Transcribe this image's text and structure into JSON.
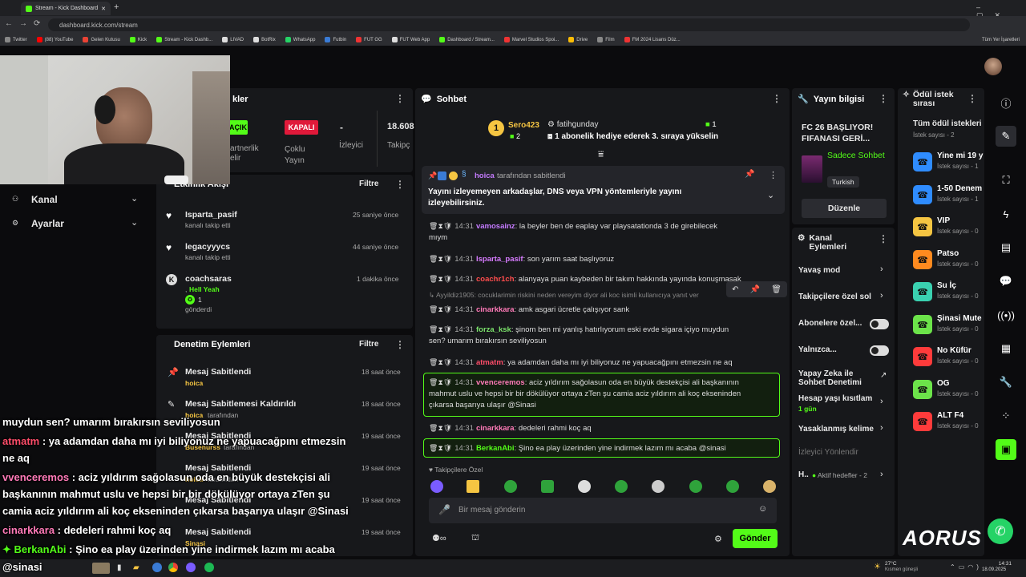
{
  "browser": {
    "tab_title": "Stream - Kick Dashboard",
    "url": "dashboard.kick.com/stream",
    "bookmarks": [
      "Twitter",
      "(88) YouTube",
      "Gelen Kutusu",
      "Kick",
      "Stream - Kick Dashb...",
      "LIVAD",
      "BotRix",
      "WhatsApp",
      "Futbin",
      "FUT GG",
      "FUT Web App",
      "Dashboard / Stream...",
      "Marvel Studios Spoi...",
      "Drive",
      "Film",
      "FM 2024 Lisans Düz..."
    ],
    "all_bookmarks": "Tüm Yer İşaretleri"
  },
  "stats_panel": {
    "title": "kler",
    "on_label": "AÇIK",
    "off_label": "KAPALI",
    "multi_label": "Çoklu Yayın",
    "partner_label": "artnerlik elir",
    "viewers_value": "-",
    "viewers_label": "İzleyici",
    "followers_value": "18.608",
    "followers_label": "Takipç"
  },
  "left_nav": {
    "channel": "Kanal",
    "settings": "Ayarlar"
  },
  "activity": {
    "title": "Etkinlik Akışı",
    "filter": "Filtre",
    "items": [
      {
        "user": "Isparta_pasif",
        "action": "kanalı takip etti",
        "time": "25 saniye önce"
      },
      {
        "user": "legacyyycs",
        "action": "kanalı takip etti",
        "time": "44 saniye önce"
      },
      {
        "user": "coachsaras",
        "action": ", ",
        "highlight": "Hell Yeah",
        "count": "1",
        "action2": "gönderdi",
        "time": "1 dakika önce"
      }
    ]
  },
  "moderation": {
    "title": "Denetim Eylemleri",
    "filter": "Filtre",
    "items": [
      {
        "action": "Mesaj Sabitlendi",
        "by": "hoica",
        "suffix": "tarafından",
        "time": "18 saat önce"
      },
      {
        "action": "Mesaj Sabitlemesi Kaldırıldı",
        "by": "hoica",
        "suffix": "tarafından",
        "time": "18 saat önce"
      },
      {
        "action": "Mesaj Sabitlendi",
        "by": "Busenurss",
        "suffix": "tarafından",
        "time": "19 saat önce"
      },
      {
        "action": "Mesaj Sabitlendi",
        "by": "hoica",
        "suffix": "tarafından",
        "time": "19 saat önce"
      },
      {
        "action": "Mesaj Sabitlendi",
        "by": "",
        "suffix": "",
        "time": "19 saat önce"
      },
      {
        "action": "Mesaj Sabitlendi",
        "by": "Sinasi",
        "suffix": "tarafından",
        "time": "19 saat önce"
      }
    ]
  },
  "overlay": {
    "line0": "muydun sen? umarım bırakırsın seviliyosun",
    "l1_user": "atmatm",
    "l1_text": " : ya adamdan daha mı iyi biliyonuz ne yapuacağpını etmezsin",
    "l1b": "ne aq",
    "l2_user": "vvenceremos",
    "l2_text": " : aciz yıldırım sağolasun oda en büyük destekçisi ali",
    "l2b": "başkanının mahmut uslu ve hepsi bir bir dökülüyor ortaya zTen şu",
    "l2c": "camia aciz yıldırım ali koç ekseninden çıkarsa başarıya ulaşır @Sinasi",
    "l3_user": "cinarkkara",
    "l3_text": " : dedeleri rahmi koç aq",
    "l4_user": "BerkanAbi",
    "l4_text": " : Şino ea play üzerinden yine indirmek lazım mı acaba",
    "l5": "@sinasi"
  },
  "chat": {
    "title": "Sohbet",
    "top_user": "Sero423",
    "top_count": "2",
    "sub_user": "fatihgunday",
    "sub_count": "1",
    "sub_text": "1 abonelik hediye ederek 3. sıraya yükselin",
    "pinned_by": "hoica",
    "pinned_suffix": "tarafından sabitlendi",
    "pinned_text": "Yayını izleyemeyen arkadaşlar, DNS veya VPN yöntemleriyle yayını izleyebilirsiniz.",
    "reply_preview": "Ayyildiz1905: cocuklarimin riskini neden vereyim diyor ali koc isimli kullanıcıya yanıt ver",
    "messages": [
      {
        "time": "14:31",
        "user": "vamosainz",
        "color": "#c57bff",
        "text": "la beyler ben de eaplay var playsatationda 3 de girebilecek",
        "text2": "mıym"
      },
      {
        "time": "14:31",
        "user": "Isparta_pasif",
        "color": "#d77bff",
        "text": "son yarım saat başlıyoruz"
      },
      {
        "time": "14:31",
        "user": "coachr1ch",
        "color": "#ff4d4d",
        "text": "alanyaya puan kaybeden bir takım hakkında yayında konuşmasak"
      },
      {
        "time": "14:31",
        "user": "cinarkkara",
        "color": "#ff7ab8",
        "text": "amk asgari ücretle çalışıyor sank"
      },
      {
        "time": "14:31",
        "user": "forza_ksk",
        "color": "#7be26b",
        "text": "şinom ben mi yanlış hatırlıyorum eski evde sigara içiyo muydun",
        "text2": "sen? umarım bırakırsın seviliyosun"
      },
      {
        "time": "14:31",
        "user": "atmatm",
        "color": "#ff4d6a",
        "text": "ya adamdan daha mı iyi biliyonuz ne yapuacağpını etmezsin ne aq"
      },
      {
        "time": "14:31",
        "user": "vvenceremos",
        "color": "#ff7ab8",
        "text": "aciz yıldırım sağolasun oda en büyük destekçisi ali başkanının",
        "text2": "mahmut uslu ve hepsi bir bir dökülüyor ortaya zTen şu camia aciz yıldırım ali koç ekseninden",
        "text3": "çıkarsa başarıya ulaşır @Sinasi"
      },
      {
        "time": "14:31",
        "user": "cinarkkara",
        "color": "#ff7ab8",
        "text": "dedeleri rahmi koç aq"
      },
      {
        "time": "14:31",
        "user": "BerkanAbi",
        "color": "#53fc18",
        "text": "Şino ea play üzerinden yine indirmek lazım mı acaba @sinasi"
      }
    ],
    "followers_only": "Takipçilere Özel",
    "input_placeholder": "Bir mesaj gönderin",
    "send": "Gönder"
  },
  "stream_info": {
    "title": "Yayın bilgisi",
    "stream_title": "FC 26 BAŞLIYOR! FIFANASI GERİ...",
    "category": "Sadece Sohbet",
    "language": "Turkish",
    "edit": "Düzenle"
  },
  "channel_actions": {
    "title": "Kanal Eylemleri",
    "slow": "Yavaş mod",
    "followers": "Takipçilere özel sol",
    "subscribers": "Abonelere özel...",
    "only": "Yalnızca...",
    "ai": "Yapay Zeka ile Sohbet Denetimi",
    "age": "Hesap yaşı kısıtlam",
    "age_value": "1 gün",
    "banned": "Yasaklanmış kelime",
    "viewer_dir": "İzleyici Yönlendir",
    "h_label": "H..",
    "goals": "Aktif hedefler - 2"
  },
  "rewards": {
    "title": "Ödül istek sırası",
    "all": "Tüm ödül istekleri",
    "all_count": "İstek sayısı - 2",
    "items": [
      {
        "name": "Yine mi 19 y",
        "count": "İstek sayısı - 1",
        "color": "#2f8cff"
      },
      {
        "name": "1-50 Denem",
        "count": "İstek sayısı - 1",
        "color": "#2f8cff"
      },
      {
        "name": "VIP",
        "count": "İstek sayısı - 0",
        "color": "#f5c542"
      },
      {
        "name": "Patso",
        "count": "İstek sayısı - 0",
        "color": "#ff8a1f"
      },
      {
        "name": "Su İç",
        "count": "İstek sayısı - 0",
        "color": "#3ad1b0"
      },
      {
        "name": "Şinasi Mute",
        "count": "İstek sayısı - 0",
        "color": "#6ce34a"
      },
      {
        "name": "No Küfür",
        "count": "İstek sayısı - 0",
        "color": "#ff3b3b"
      },
      {
        "name": "OG",
        "count": "İstek sayısı - 0",
        "color": "#6ce34a"
      },
      {
        "name": "ALT F4",
        "count": "İstek sayısı - 0",
        "color": "#ff3b3b"
      }
    ]
  },
  "taskbar": {
    "weather_temp": "27°C",
    "weather_text": "Kısmen güneşli",
    "time": "14:31",
    "date": "18.09.2025"
  },
  "brand": "AORUS"
}
